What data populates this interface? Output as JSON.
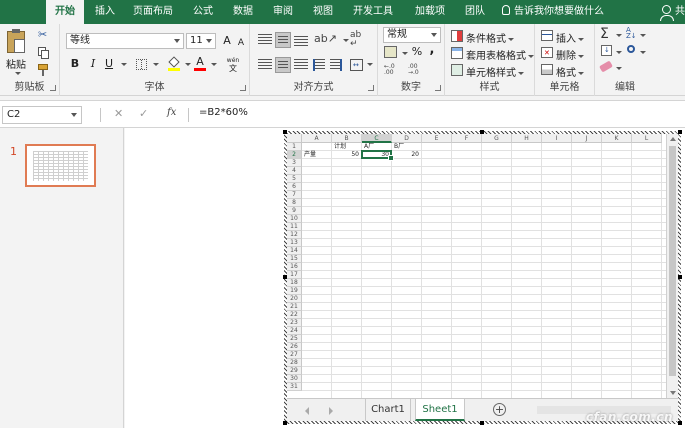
{
  "ribbon_tabs": [
    {
      "label": "开始",
      "active": true
    },
    {
      "label": "插入"
    },
    {
      "label": "页面布局"
    },
    {
      "label": "公式"
    },
    {
      "label": "数据"
    },
    {
      "label": "审阅"
    },
    {
      "label": "视图"
    },
    {
      "label": "开发工具"
    },
    {
      "label": "加载项"
    },
    {
      "label": "团队"
    }
  ],
  "tell_me": "告诉我你想要做什么",
  "user_label": "共",
  "groups": {
    "clipboard": {
      "label": "剪贴板",
      "paste": "粘贴"
    },
    "font": {
      "label": "字体",
      "font_name": "等线",
      "font_size": "11",
      "bold": "B",
      "italic": "I",
      "underline": "U",
      "grow": "A",
      "shrink": "A",
      "font_color_letter": "A",
      "wen": "wén"
    },
    "alignment": {
      "label": "对齐方式"
    },
    "number": {
      "label": "数字",
      "format": "常规",
      "percent": "%",
      "comma": ","
    },
    "styles": {
      "label": "样式",
      "conditional": "条件格式",
      "table": "套用表格格式",
      "cell_styles": "单元格样式"
    },
    "cells": {
      "label": "单元格",
      "insert": "插入",
      "delete": "删除",
      "format": "格式"
    },
    "editing": {
      "label": "编辑"
    }
  },
  "formula_bar": {
    "name_box": "C2",
    "fx": "fx",
    "formula": "=B2*60%"
  },
  "slides": {
    "number": "1"
  },
  "sheet": {
    "columns": [
      "A",
      "B",
      "C",
      "D",
      "E",
      "F",
      "G",
      "H",
      "I",
      "J",
      "K",
      "L"
    ],
    "selected_column": "C",
    "rows": [
      "1",
      "2",
      "3",
      "4",
      "5",
      "6",
      "7",
      "8",
      "9",
      "10",
      "11",
      "12",
      "13",
      "14",
      "15",
      "16",
      "17",
      "18",
      "19",
      "20",
      "21",
      "22",
      "23",
      "24",
      "25",
      "26",
      "27",
      "28",
      "29",
      "30",
      "31"
    ],
    "selected_row": "2",
    "cells": {
      "B1": "计划",
      "C1": "A厂",
      "D1": "B厂",
      "A2": "产量",
      "B2": "50",
      "C2": "30",
      "D2": "20"
    },
    "tabs": [
      {
        "label": "Chart1"
      },
      {
        "label": "Sheet1",
        "active": true
      }
    ],
    "add_sheet": "+"
  },
  "watermark": "cfan.com.cn",
  "colors": {
    "accent": "#217346",
    "slide_number": "#d24726"
  }
}
